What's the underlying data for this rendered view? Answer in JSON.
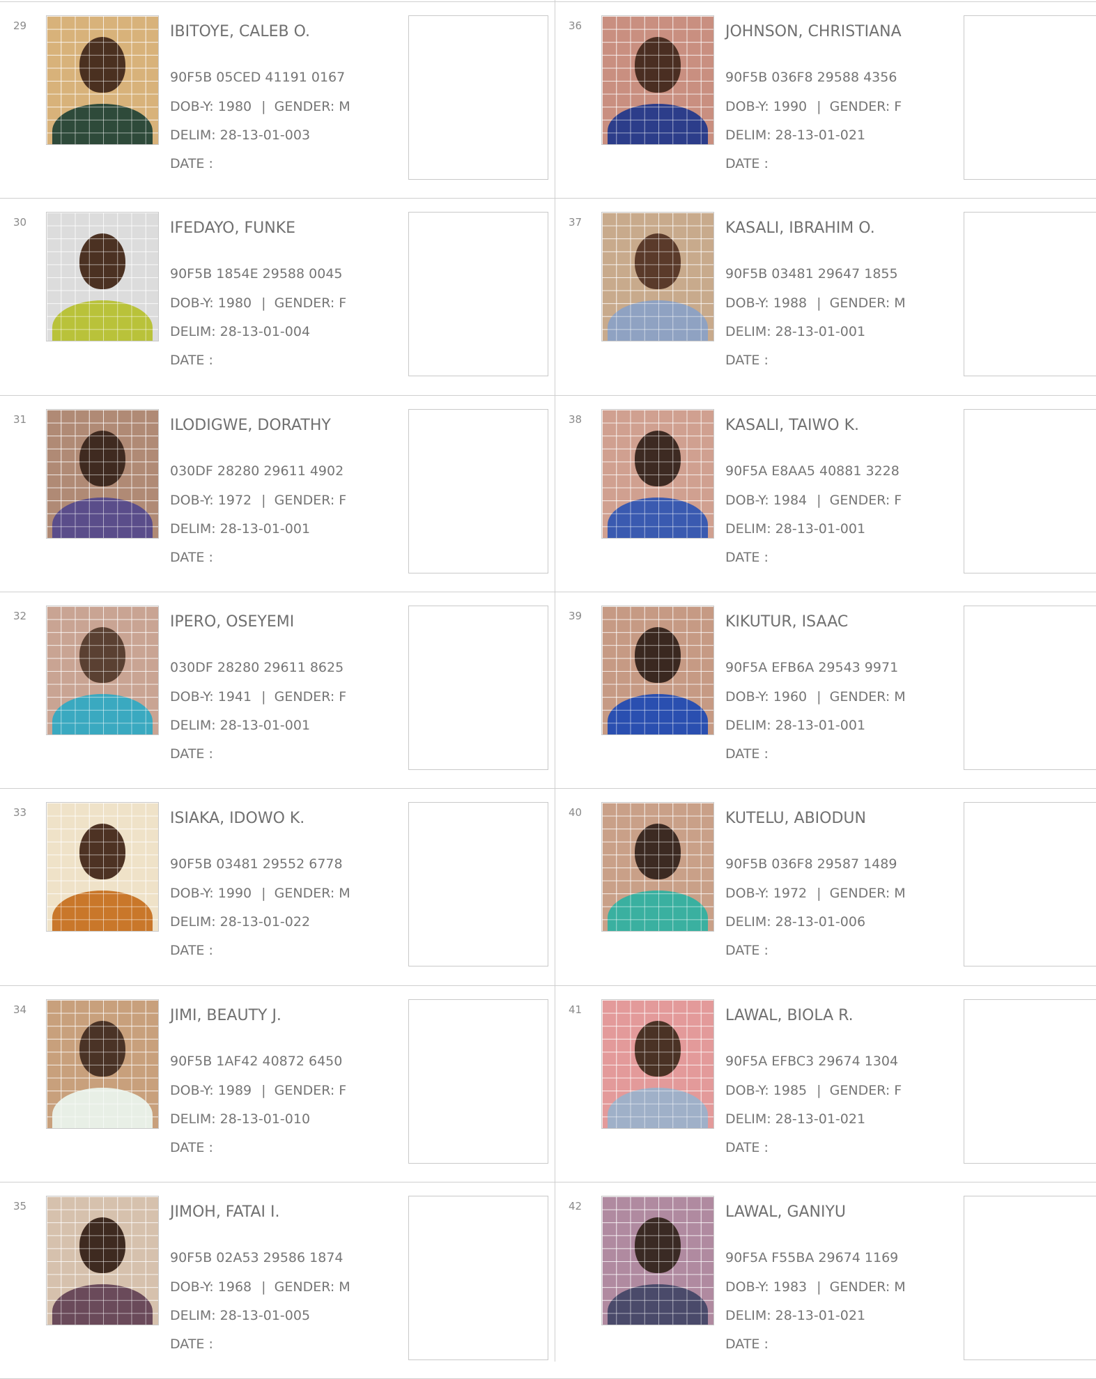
{
  "labels": {
    "dob": "DOB-Y:",
    "gender": "GENDER:",
    "sep": "|",
    "delim": "DELIM:",
    "date": "DATE :"
  },
  "records": [
    {
      "num": "29",
      "name": "IBITOYE, CALEB O.",
      "id": "90F5B 05CED 41191 0167",
      "dob": "1980",
      "gender": "M",
      "delim": "28-13-01-003",
      "bg": "#d8b27a",
      "skin": "#4a3020",
      "cloth": "#2e4a3a"
    },
    {
      "num": "30",
      "name": "IFEDAYO, FUNKE",
      "id": "90F5B 1854E 29588 0045",
      "dob": "1980",
      "gender": "F",
      "delim": "28-13-01-004",
      "bg": "#dcdcdc",
      "skin": "#4b3122",
      "cloth": "#b9c23a"
    },
    {
      "num": "31",
      "name": "ILODIGWE, DORATHY",
      "id": "030DF 28280 29611 4902",
      "dob": "1972",
      "gender": "F",
      "delim": "28-13-01-001",
      "bg": "#b08a75",
      "skin": "#3f2a20",
      "cloth": "#5a4d8a"
    },
    {
      "num": "32",
      "name": "IPERO, OSEYEMI",
      "id": "030DF 28280 29611 8625",
      "dob": "1941",
      "gender": "F",
      "delim": "28-13-01-001",
      "bg": "#c9a493",
      "skin": "#5a4032",
      "cloth": "#3aa9c0"
    },
    {
      "num": "33",
      "name": "ISIAKA, IDOWO K.",
      "id": "90F5B 03481 29552 6778",
      "dob": "1990",
      "gender": "M",
      "delim": "28-13-01-022",
      "bg": "#efe2c8",
      "skin": "#4d3223",
      "cloth": "#c9772a"
    },
    {
      "num": "34",
      "name": "JIMI, BEAUTY J.",
      "id": "90F5B 1AF42 40872 6450",
      "dob": "1989",
      "gender": "F",
      "delim": "28-13-01-010",
      "bg": "#c8a07c",
      "skin": "#4a3326",
      "cloth": "#e8efe6"
    },
    {
      "num": "35",
      "name": "JIMOH, FATAI I.",
      "id": "90F5B 02A53 29586 1874",
      "dob": "1968",
      "gender": "M",
      "delim": "28-13-01-005",
      "bg": "#d6c1ad",
      "skin": "#3e2a20",
      "cloth": "#6a4a5a"
    },
    {
      "num": "36",
      "name": "JOHNSON, CHRISTIANA",
      "id": "90F5B 036F8 29588 4356",
      "dob": "1990",
      "gender": "F",
      "delim": "28-13-01-021",
      "bg": "#c98f80",
      "skin": "#4a2e22",
      "cloth": "#2c3d8a"
    },
    {
      "num": "37",
      "name": "KASALI, IBRAHIM O.",
      "id": "90F5B 03481 29647 1855",
      "dob": "1988",
      "gender": "M",
      "delim": "28-13-01-001",
      "bg": "#c8aa8c",
      "skin": "#5a3a2a",
      "cloth": "#8fa2c2"
    },
    {
      "num": "38",
      "name": "KASALI, TAIWO K.",
      "id": "90F5A E8AA5 40881 3228",
      "dob": "1984",
      "gender": "F",
      "delim": "28-13-01-001",
      "bg": "#d0a090",
      "skin": "#3d2a22",
      "cloth": "#3a5ab0"
    },
    {
      "num": "39",
      "name": "KIKUTUR, ISAAC",
      "id": "90F5A EFB6A 29543 9971",
      "dob": "1960",
      "gender": "M",
      "delim": "28-13-01-001",
      "bg": "#c69a84",
      "skin": "#3a2820",
      "cloth": "#2a4fb0"
    },
    {
      "num": "40",
      "name": "KUTELU, ABIODUN",
      "id": "90F5B 036F8 29587 1489",
      "dob": "1972",
      "gender": "M",
      "delim": "28-13-01-006",
      "bg": "#c9a088",
      "skin": "#3c2a22",
      "cloth": "#3ab0a0"
    },
    {
      "num": "41",
      "name": "LAWAL, BIOLA R.",
      "id": "90F5A EFBC3 29674 1304",
      "dob": "1985",
      "gender": "F",
      "delim": "28-13-01-021",
      "bg": "#e39a9a",
      "skin": "#4a3225",
      "cloth": "#9fb0c8"
    },
    {
      "num": "42",
      "name": "LAWAL, GANIYU",
      "id": "90F5A F55BA 29674 1169",
      "dob": "1983",
      "gender": "M",
      "delim": "28-13-01-021",
      "bg": "#b08aa0",
      "skin": "#3a2a24",
      "cloth": "#4a4a6a"
    }
  ]
}
